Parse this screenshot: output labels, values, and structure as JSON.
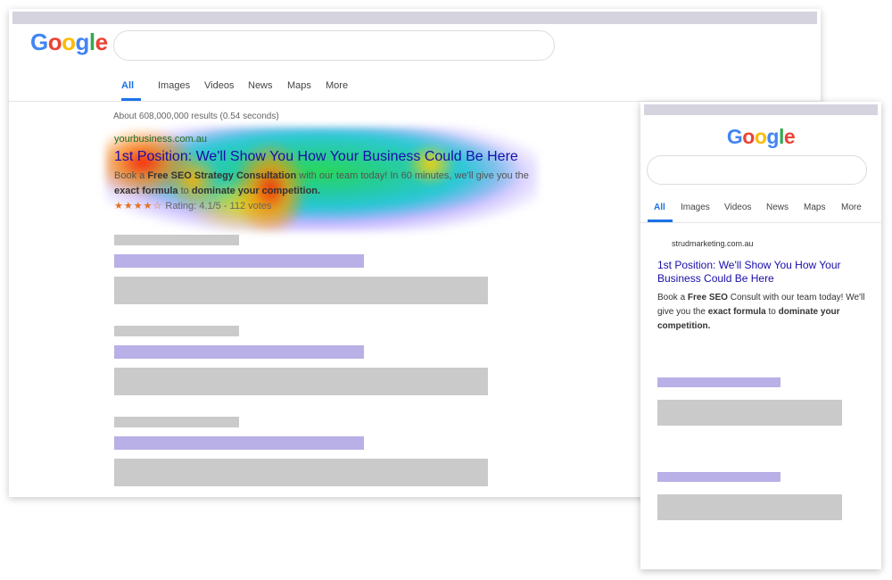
{
  "desktop": {
    "logo": [
      {
        "char": "G",
        "color": "#4285F4"
      },
      {
        "char": "o",
        "color": "#EA4335"
      },
      {
        "char": "o",
        "color": "#FBBC05"
      },
      {
        "char": "g",
        "color": "#4285F4"
      },
      {
        "char": "l",
        "color": "#34A853"
      },
      {
        "char": "e",
        "color": "#EA4335"
      }
    ],
    "tabs": [
      "All",
      "Images",
      "Videos",
      "News",
      "Maps",
      "More"
    ],
    "active_tab": "All",
    "stats": "About 608,000,000 results (0.54 seconds)",
    "result": {
      "url": "yourbusiness.com.au",
      "title": "1st Position: We'll Show You How Your Business Could Be Here",
      "desc": [
        {
          "text": "Book a ",
          "bold": false
        },
        {
          "text": "Free SEO Strategy Consultation",
          "bold": true
        },
        {
          "text": " with our team today! In 60 minutes, we'll give you the ",
          "bold": false
        },
        {
          "text": "exact formula",
          "bold": true
        },
        {
          "text": " to ",
          "bold": false
        },
        {
          "text": "dominate your competition.",
          "bold": true
        }
      ],
      "stars": "★★★★☆",
      "rating": "Rating: 4.1/5 - 112 votes"
    }
  },
  "mobile": {
    "logo": [
      {
        "char": "G",
        "color": "#4285F4"
      },
      {
        "char": "o",
        "color": "#EA4335"
      },
      {
        "char": "o",
        "color": "#FBBC05"
      },
      {
        "char": "g",
        "color": "#4285F4"
      },
      {
        "char": "l",
        "color": "#34A853"
      },
      {
        "char": "e",
        "color": "#EA4335"
      }
    ],
    "tabs": [
      "All",
      "Images",
      "Videos",
      "News",
      "Maps",
      "More"
    ],
    "active_tab": "All",
    "result": {
      "url": "strudmarketing.com.au",
      "title": "1st Position: We'll Show You How Your Business Could Be Here",
      "desc": [
        {
          "text": "Book a ",
          "bold": false
        },
        {
          "text": "Free SEO",
          "bold": true
        },
        {
          "text": " Consult with our team today! We'll give you the ",
          "bold": false
        },
        {
          "text": "exact formula",
          "bold": true
        },
        {
          "text": " to ",
          "bold": false
        },
        {
          "text": "dominate your competition.",
          "bold": true
        }
      ]
    }
  },
  "colors": {
    "link": "#1a0dab",
    "url_green": "#1d6b22",
    "accent": "#1a73e8",
    "placeholder_gray": "#cacaca",
    "placeholder_purple": "#b8b0e6",
    "window_bar": "#d4d3de"
  }
}
